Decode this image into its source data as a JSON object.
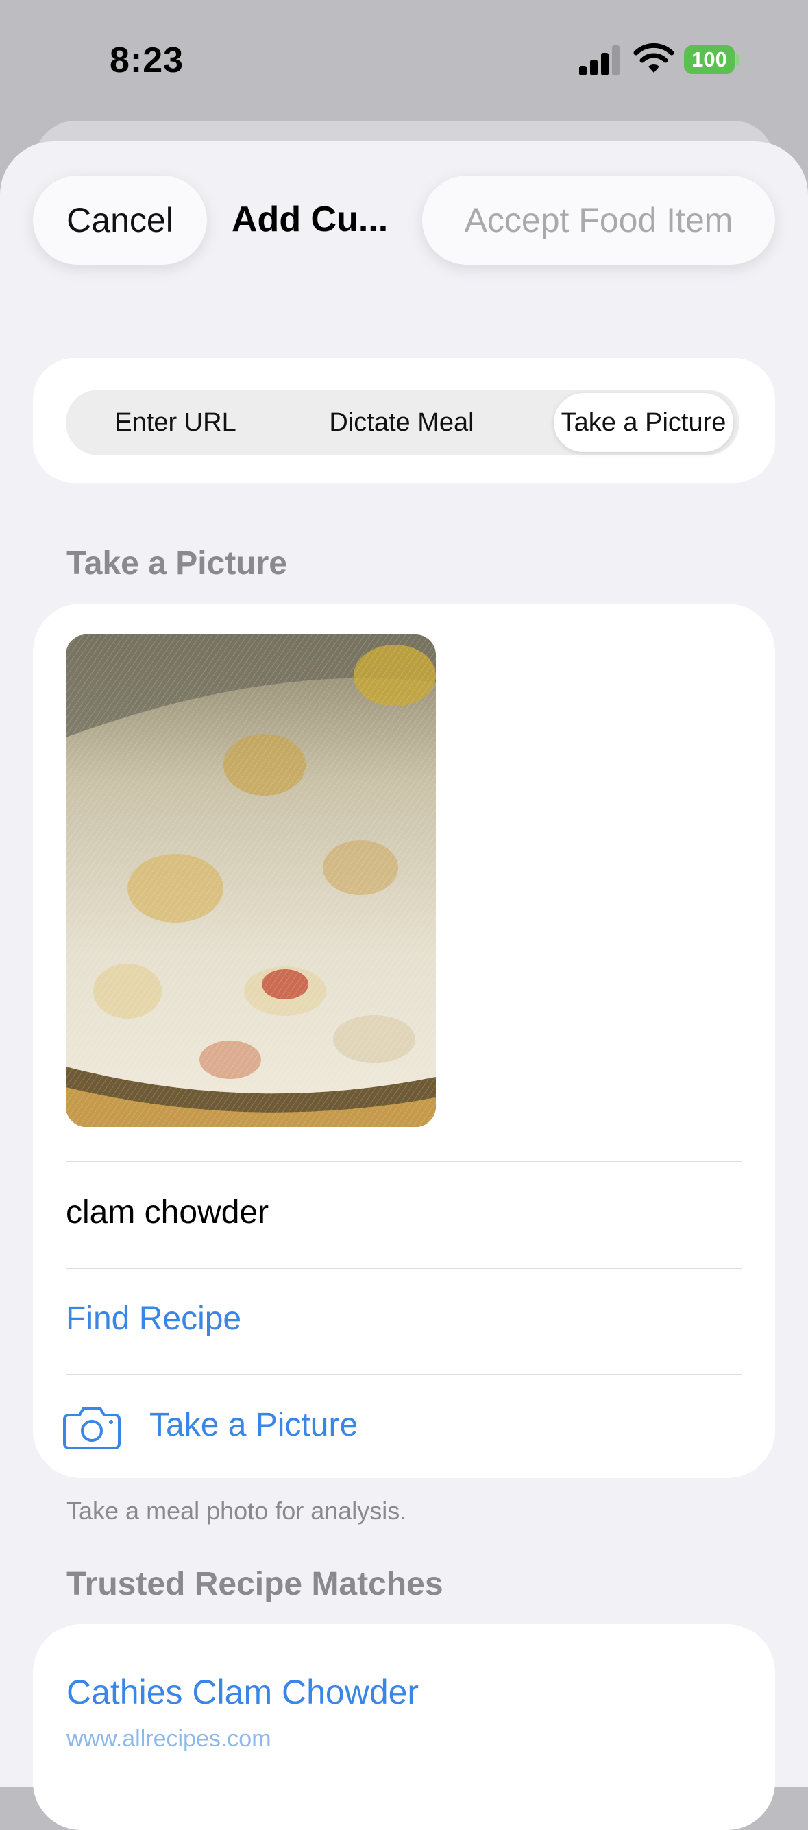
{
  "status_bar": {
    "time": "8:23",
    "battery": "100"
  },
  "nav": {
    "cancel_label": "Cancel",
    "title": "Add Cu...",
    "accept_label": "Accept Food Item"
  },
  "segments": {
    "items": [
      "Enter URL",
      "Dictate Meal",
      "Take a Picture"
    ],
    "selected": "Take a Picture"
  },
  "picture_section": {
    "header": "Take a Picture",
    "food_name": "clam chowder",
    "find_recipe_label": "Find Recipe",
    "take_picture_label": "Take a Picture",
    "footnote": "Take a meal photo for analysis."
  },
  "recipes_section": {
    "header": "Trusted Recipe Matches",
    "items": [
      {
        "title": "Cathies Clam Chowder",
        "source": "www.allrecipes.com"
      }
    ]
  },
  "colors": {
    "accent": "#3a86e6",
    "battery": "#5ac04f",
    "sheet_background": "#f1f1f6"
  }
}
